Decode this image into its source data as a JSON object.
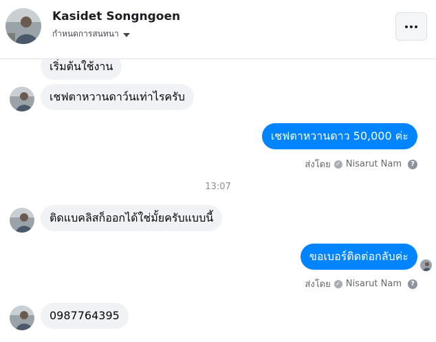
{
  "header": {
    "name": "Kasidet Songngoen",
    "subtitle": "กำหนดการสนทนา",
    "more_label": "more-options"
  },
  "messages": [
    {
      "id": "m0",
      "direction": "in",
      "text": "เริ่มต้นใช้งาน"
    },
    {
      "id": "m1",
      "direction": "in",
      "text": "เชฟตาหวานดาว์นเท่าไรครับ"
    },
    {
      "id": "m2",
      "direction": "out",
      "text": "เชฟตาหวานดาว 50,000 ค่ะ"
    },
    {
      "id": "m3",
      "direction": "in",
      "text": "ติดแบคลิสก็ออกได้ใช่มั้ยครับแบบนี้"
    },
    {
      "id": "m4",
      "direction": "out",
      "text": "ขอเบอร์ติดต่อกลับค่ะ"
    },
    {
      "id": "m5",
      "direction": "in",
      "text": "0987764395"
    }
  ],
  "sent_by": {
    "prefix": "ส่งโดย",
    "name": "Nisarut Nam",
    "help": "?"
  },
  "timestamp": "13:07",
  "colors": {
    "outgoing_bubble": "#0084ff",
    "incoming_bubble": "#f0f2f5"
  }
}
